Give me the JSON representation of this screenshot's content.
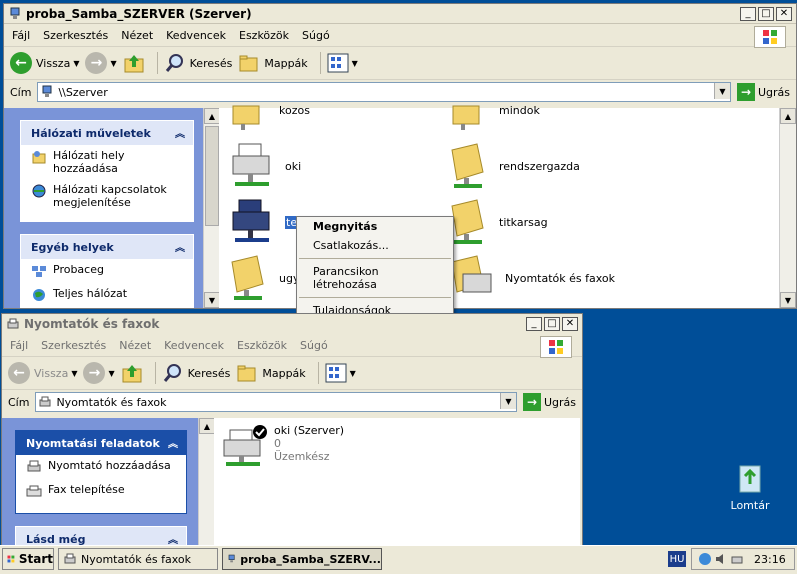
{
  "top_window": {
    "title": "proba_Samba_SZERVER (Szerver)",
    "menu": [
      "Fájl",
      "Szerkesztés",
      "Nézet",
      "Kedvencek",
      "Eszközök",
      "Súgó"
    ],
    "toolbar": {
      "back": "Vissza",
      "search": "Keresés",
      "folders": "Mappák"
    },
    "address_label": "Cím",
    "address_value": "\\\\Szerver",
    "go_label": "Ugrás",
    "left_panels": [
      {
        "title": "Hálózati műveletek",
        "items": [
          "Hálózati hely hozzáadása",
          "Hálózati kapcsolatok megjelenítése"
        ]
      },
      {
        "title": "Egyéb helyek",
        "items": [
          "Probaceg",
          "Teljes hálózat"
        ]
      }
    ],
    "items": {
      "top_left_partial": "kozos",
      "top_right_partial": "mindok",
      "oki": "oki",
      "rendszergazda": "rendszergazda",
      "teszt": "teszt",
      "titkarsag": "titkarsag",
      "ugy": "ugy",
      "printers": "Nyomtatók és faxok"
    },
    "context_menu": {
      "open": "Megnyitás",
      "connect": "Csatlakozás...",
      "shortcut": "Parancsikon létrehozása",
      "properties": "Tulajdonságok"
    }
  },
  "bottom_window": {
    "title": "Nyomtatók és faxok",
    "menu": [
      "Fájl",
      "Szerkesztés",
      "Nézet",
      "Kedvencek",
      "Eszközök",
      "Súgó"
    ],
    "toolbar": {
      "back": "Vissza",
      "search": "Keresés",
      "folders": "Mappák"
    },
    "address_label": "Cím",
    "address_value": "Nyomtatók és faxok",
    "go_label": "Ugrás",
    "task_panel": {
      "title": "Nyomtatási feladatok",
      "items": [
        "Nyomtató hozzáadása",
        "Fax telepítése"
      ]
    },
    "see_also": "Lásd még",
    "printer": {
      "name": "oki (Szerver)",
      "jobs": "0",
      "status": "Üzemkész"
    }
  },
  "taskbar": {
    "start": "Start",
    "tasks": [
      "Nyomtatók és faxok",
      "proba_Samba_SZERV..."
    ],
    "lang": "HU",
    "clock": "23:16"
  },
  "desktop": {
    "recycle_bin": "Lomtár"
  }
}
